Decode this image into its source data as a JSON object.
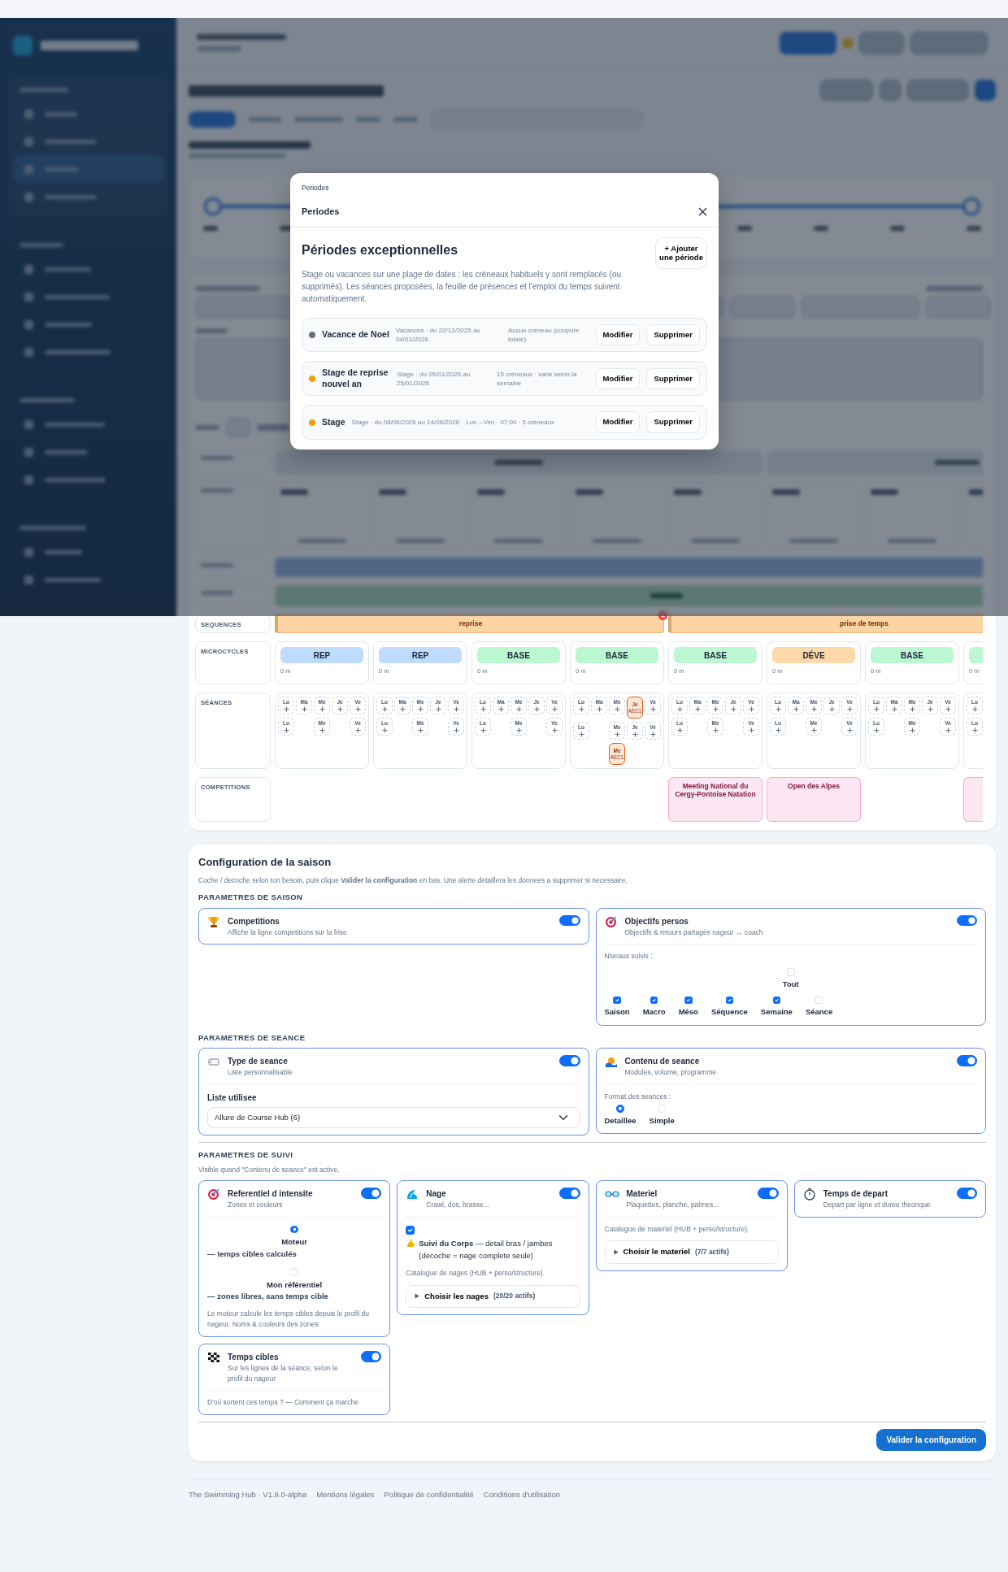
{
  "frise": {
    "row_labels": [
      "SEQUENCES",
      "MICROCYCLES",
      "SÉANCES",
      "COMPETITIONS"
    ],
    "weeks": [
      {
        "sequence": {
          "label": "reprise",
          "removable": true
        },
        "microcycle": {
          "label": "REP",
          "color": "#bfdbfe",
          "distance": "0 m"
        },
        "sessions": [
          [
            {
              "kind": "add",
              "day": "Lu"
            },
            {
              "kind": "add",
              "day": "Ma"
            },
            {
              "kind": "add",
              "day": "Me"
            },
            {
              "kind": "add",
              "day": "Je"
            },
            {
              "kind": "add",
              "day": "Ve"
            }
          ],
          [
            {
              "kind": "add",
              "day": "Lu"
            },
            {
              "kind": "none"
            },
            {
              "kind": "add",
              "day": "Me"
            },
            {
              "kind": "none"
            },
            {
              "kind": "add",
              "day": "Ve"
            }
          ]
        ]
      },
      {
        "microcycle": {
          "label": "REP",
          "color": "#bfdbfe",
          "distance": "0 m"
        },
        "sessions": [
          [
            {
              "kind": "add",
              "day": "Lu"
            },
            {
              "kind": "add",
              "day": "Ma"
            },
            {
              "kind": "add",
              "day": "Me"
            },
            {
              "kind": "add",
              "day": "Je"
            },
            {
              "kind": "add",
              "day": "Ve"
            }
          ],
          [
            {
              "kind": "add",
              "day": "Lu"
            },
            {
              "kind": "none"
            },
            {
              "kind": "add",
              "day": "Me"
            },
            {
              "kind": "none"
            },
            {
              "kind": "add",
              "day": "Ve"
            }
          ]
        ]
      },
      {
        "microcycle": {
          "label": "BASE",
          "color": "#bbf7d0",
          "distance": "0 m"
        },
        "sessions": [
          [
            {
              "kind": "add",
              "day": "Lu"
            },
            {
              "kind": "add",
              "day": "Ma"
            },
            {
              "kind": "add",
              "day": "Me"
            },
            {
              "kind": "add",
              "day": "Je"
            },
            {
              "kind": "add",
              "day": "Ve"
            }
          ],
          [
            {
              "kind": "add",
              "day": "Lu"
            },
            {
              "kind": "none"
            },
            {
              "kind": "add",
              "day": "Me"
            },
            {
              "kind": "none"
            },
            {
              "kind": "add",
              "day": "Ve"
            }
          ]
        ]
      },
      {
        "microcycle": {
          "label": "BASE",
          "color": "#bbf7d0",
          "distance": "0 m"
        },
        "sessions": [
          [
            {
              "kind": "add",
              "day": "Lu"
            },
            {
              "kind": "add",
              "day": "Ma"
            },
            {
              "kind": "add",
              "day": "Me"
            },
            {
              "kind": "session",
              "day": "Je",
              "code": "AEC1"
            },
            {
              "kind": "add",
              "day": "Ve"
            }
          ],
          [
            {
              "kind": "add",
              "day": "Lu"
            },
            {
              "kind": "none"
            },
            {
              "kind": "add",
              "day": "Me"
            },
            {
              "kind": "add",
              "day": "Je"
            },
            {
              "kind": "add",
              "day": "Ve"
            }
          ],
          [
            {
              "kind": "none"
            },
            {
              "kind": "none"
            },
            {
              "kind": "session",
              "day": "Me",
              "code": "AEC1"
            },
            {
              "kind": "none"
            },
            {
              "kind": "none"
            }
          ]
        ]
      },
      {
        "sequence": {
          "label": "prise de temps",
          "removable": false
        },
        "microcycle": {
          "label": "BASE",
          "color": "#bbf7d0",
          "distance": "0 m"
        },
        "sessions": [
          [
            {
              "kind": "add",
              "day": "Lu"
            },
            {
              "kind": "add",
              "day": "Ma"
            },
            {
              "kind": "add",
              "day": "Me"
            },
            {
              "kind": "add",
              "day": "Je"
            },
            {
              "kind": "add",
              "day": "Ve"
            }
          ],
          [
            {
              "kind": "add",
              "day": "Lu"
            },
            {
              "kind": "none"
            },
            {
              "kind": "add",
              "day": "Me"
            },
            {
              "kind": "none"
            },
            {
              "kind": "add",
              "day": "Ve"
            }
          ]
        ],
        "competition": {
          "label": "Meeting National du Cergy-Pontoise Natation",
          "cut": false
        }
      },
      {
        "microcycle": {
          "label": "DÉVE",
          "color": "#fed7aa",
          "distance": "0 m"
        },
        "sessions": [
          [
            {
              "kind": "add",
              "day": "Lu"
            },
            {
              "kind": "add",
              "day": "Ma"
            },
            {
              "kind": "add",
              "day": "Me"
            },
            {
              "kind": "add",
              "day": "Je"
            },
            {
              "kind": "add",
              "day": "Ve"
            }
          ],
          [
            {
              "kind": "add",
              "day": "Lu"
            },
            {
              "kind": "none"
            },
            {
              "kind": "add",
              "day": "Me"
            },
            {
              "kind": "none"
            },
            {
              "kind": "add",
              "day": "Ve"
            }
          ]
        ],
        "competition": {
          "label": "Open des Alpes",
          "cut": false
        }
      },
      {
        "microcycle": {
          "label": "BASE",
          "color": "#bbf7d0",
          "distance": "0 m"
        },
        "sessions": [
          [
            {
              "kind": "add",
              "day": "Lu"
            },
            {
              "kind": "add",
              "day": "Ma"
            },
            {
              "kind": "add",
              "day": "Me"
            },
            {
              "kind": "add",
              "day": "Je"
            },
            {
              "kind": "add",
              "day": "Ve"
            }
          ],
          [
            {
              "kind": "add",
              "day": "Lu"
            },
            {
              "kind": "none"
            },
            {
              "kind": "add",
              "day": "Me"
            },
            {
              "kind": "none"
            },
            {
              "kind": "add",
              "day": "Ve"
            }
          ]
        ]
      },
      {
        "microcycle": {
          "color": "#bbf7d0",
          "distance": "0 m"
        },
        "sessions": [
          [
            {
              "kind": "add",
              "day": "Lu"
            }
          ],
          [
            {
              "kind": "add",
              "day": "Lu"
            }
          ]
        ],
        "competition": {
          "cut": true
        }
      }
    ]
  },
  "modal": {
    "caption": "Periodes",
    "title": "Periodes",
    "heading": "Périodes exceptionnelles",
    "description": "Stage ou vacances sur une plage de dates : les créneaux habituels y sont remplacés (ou supprimés). Les séances proposées, la feuille de présences et l'emploi du temps suivent automatiquement.",
    "add_button": "+ Ajouter une période",
    "periods": [
      {
        "name": "Vacance de Noel",
        "dates": "Vacances · du 22/12/2025 au 04/01/2026",
        "slots": "Aucun créneau (coupure totale)",
        "color": "#6b7280",
        "edit": "Modifier",
        "delete": "Supprimer"
      },
      {
        "name": "Stage de reprise nouvel an",
        "dates": "Stage · du 05/01/2026 au 25/01/2026",
        "slots": "15 créneaux · varie selon la semaine",
        "color": "#f59e0b",
        "edit": "Modifier",
        "delete": "Supprimer"
      },
      {
        "name": "Stage",
        "dates": "Stage · du 08/06/2026 au 14/06/2026",
        "slots": "Lun→Ven · 07:00 · 5 créneaux",
        "color": "#f59e0b",
        "edit": "Modifier",
        "delete": "Supprimer"
      }
    ]
  },
  "config": {
    "title": "Configuration de la saison",
    "intro": "Coche / decoche selon ton besoin, puis clique **Valider la configuration** en bas. Une alerte detaillera les donnees a supprimer si necessaire.",
    "sections": [
      {
        "title": "PARAMETRES DE SAISON",
        "cards": [
          {
            "kind": "plain",
            "title": "Competitions",
            "subtitle": "Affiche la ligne competitions sur la frise",
            "on": true
          },
          {
            "kind": "levels",
            "title": "Objectifs persos",
            "subtitle": "Objectifs & retours partagés nageur ↔ coach",
            "on": true,
            "label": "Niveaux suivis :",
            "options": [
              {
                "kind": "all",
                "label": "Tout",
                "checked": false
              },
              {
                "kind": "level",
                "label": "Saison",
                "checked": true
              },
              {
                "kind": "level",
                "label": "Macro",
                "checked": true
              },
              {
                "kind": "level",
                "label": "Méso",
                "checked": true
              },
              {
                "kind": "level",
                "label": "Séquence",
                "checked": true
              },
              {
                "kind": "level",
                "label": "Semaine",
                "checked": true
              },
              {
                "kind": "level",
                "label": "Séance",
                "checked": false
              }
            ]
          }
        ]
      },
      {
        "title": "PARAMETRES DE SEANCE",
        "cards": [
          {
            "kind": "select",
            "title": "Type de seance",
            "subtitle": "Liste personnalisable",
            "on": true,
            "label": "Liste utilisee",
            "value": "Allure de Course Hub (6)"
          },
          {
            "kind": "radios",
            "title": "Contenu de seance",
            "subtitle": "Modules, volume, programme",
            "on": true,
            "label": "Format des seances :",
            "options": [
              {
                "label": "Detaillee",
                "selected": true
              },
              {
                "label": "Simple",
                "selected": false
              }
            ]
          }
        ]
      },
      {
        "title": "PARAMETRES DE SUIVI",
        "note": "Visible quand \"Contenu de seance\" est active.",
        "cards": [
          {
            "kind": "radio_stack",
            "title": "Referentiel d intensite",
            "subtitle": "Zones et couleurs",
            "on": true,
            "options": [
              {
                "label": "Moteur",
                "description": "— temps cibles calculés",
                "selected": true
              },
              {
                "label": "Mon référentiel",
                "description": "— zones libres, sans temps cible",
                "selected": false
              }
            ],
            "note": "Le moteur calcule les temps cibles depuis le profil du nageur. Noms & couleurs des zones"
          },
          {
            "kind": "catalog",
            "title": "Nage",
            "subtitle": "Crawl, dos, brasse...",
            "on": true,
            "check": {
              "checked": true,
              "text": "**Suivi du Corps** — detail bras / jambes (decoche = nage complete seule)"
            },
            "note": "Catalogue de nages (HUB + perso/structure).",
            "picker": {
              "label": "Choisir les nages",
              "count": "(20/20 actifs)"
            }
          },
          {
            "kind": "catalog",
            "title": "Materiel",
            "subtitle": "Plaquettes, planche, palmes...",
            "on": true,
            "note": "Catalogue de materiel (HUB + perso/structure).",
            "picker": {
              "label": "Choisir le materiel",
              "count": "(7/7 actifs)"
            }
          },
          {
            "kind": "plain",
            "title": "Temps de depart",
            "subtitle": "Depart par ligne et duree theorique",
            "on": true
          },
          {
            "kind": "footnote",
            "title": "Temps cibles",
            "subtitle": "Sur les lignes de la séance, selon le profil du nageur",
            "on": true,
            "note": "D'où sortent ces temps ? — Comment ça marche"
          }
        ]
      }
    ],
    "submit": "Valider la configuration"
  },
  "footer": {
    "version": "The Swimming Hub · V1.9.0-alpha",
    "links": [
      "Mentions légales",
      "Politique de confidentialité",
      "Conditions d'utilisation"
    ]
  }
}
